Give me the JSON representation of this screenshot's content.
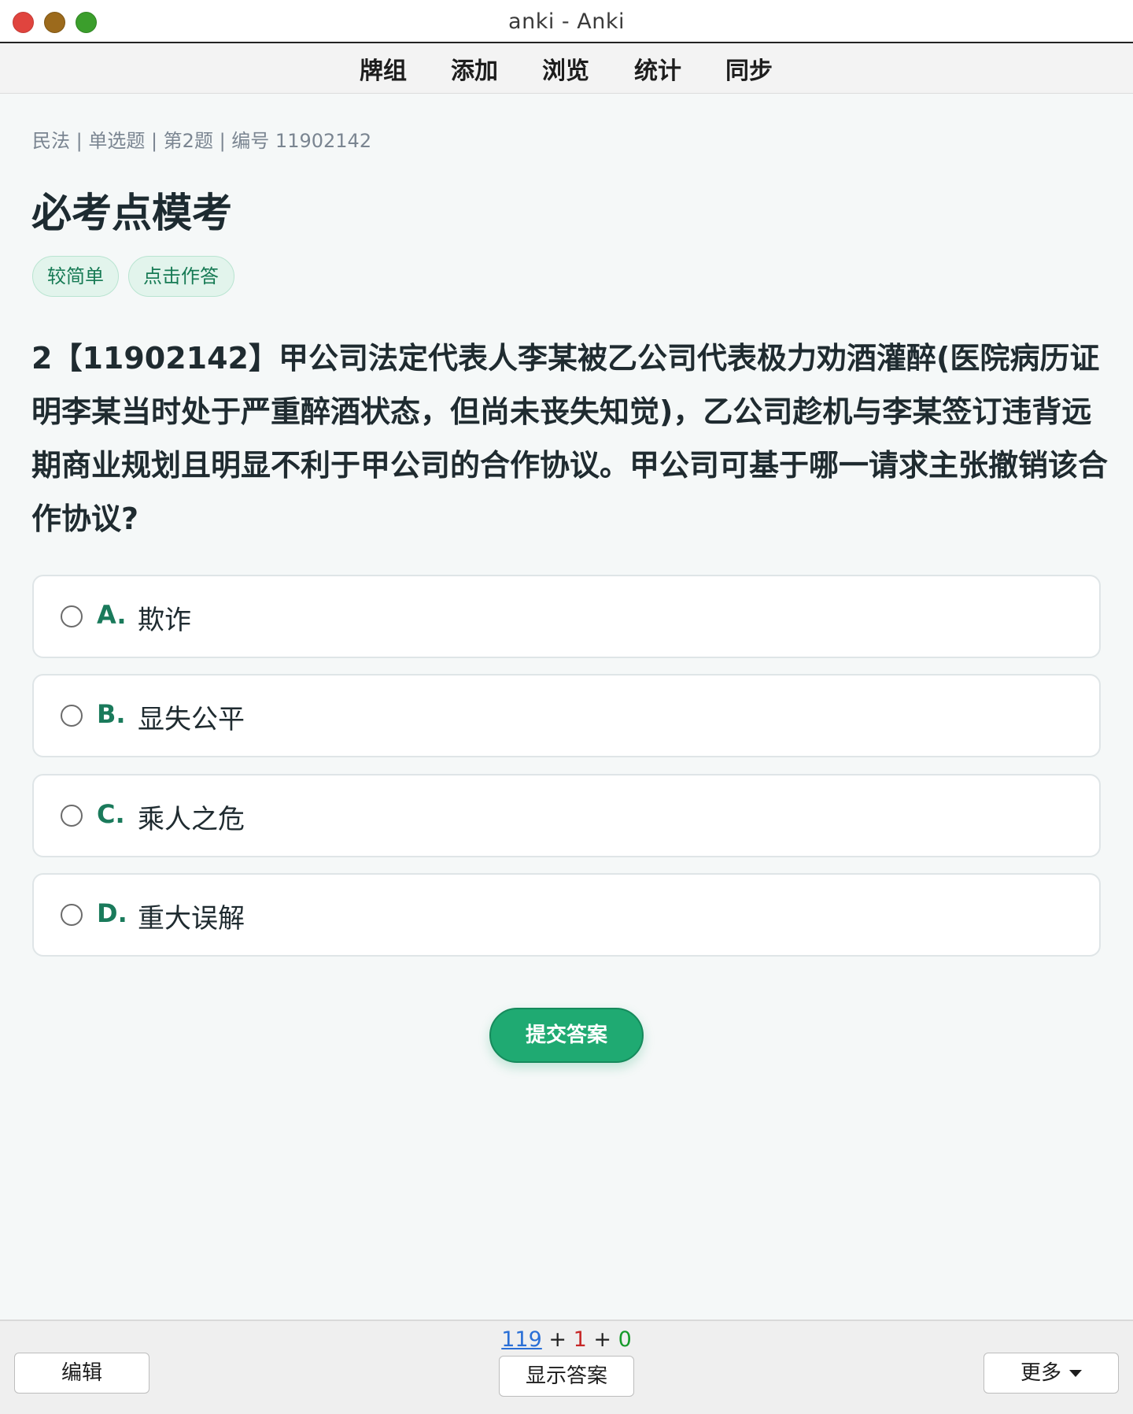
{
  "window": {
    "title": "anki - Anki"
  },
  "menu": {
    "items": [
      "牌组",
      "添加",
      "浏览",
      "统计",
      "同步"
    ]
  },
  "card": {
    "meta": "民法 | 单选题 | 第2题 | 编号 11902142",
    "title": "必考点模考",
    "tags": [
      "较简单",
      "点击作答"
    ],
    "question": "2【11902142】甲公司法定代表人李某被乙公司代表极力劝酒灌醉(医院病历证明李某当时处于严重醉酒状态，但尚未丧失知觉)，乙公司趁机与李某签订违背远期商业规划且明显不利于甲公司的合作协议。甲公司可基于哪一请求主张撤销该合作协议?",
    "options": [
      {
        "letter": "A.",
        "text": "欺诈"
      },
      {
        "letter": "B.",
        "text": "显失公平"
      },
      {
        "letter": "C.",
        "text": "乘人之危"
      },
      {
        "letter": "D.",
        "text": "重大误解"
      }
    ],
    "submit_label": "提交答案"
  },
  "bottom": {
    "counts": {
      "new": "119",
      "sep1": " + ",
      "learn": "1",
      "sep2": " + ",
      "review": "0"
    },
    "edit_label": "编辑",
    "show_answer_label": "显示答案",
    "more_label": "更多"
  },
  "colors": {
    "accent": "#1faa72",
    "tag_bg": "#e2f4ec",
    "option_letter": "#1a7a5b",
    "count_new": "#2a6fd6",
    "count_learn": "#c62828",
    "count_review": "#169a2a"
  }
}
